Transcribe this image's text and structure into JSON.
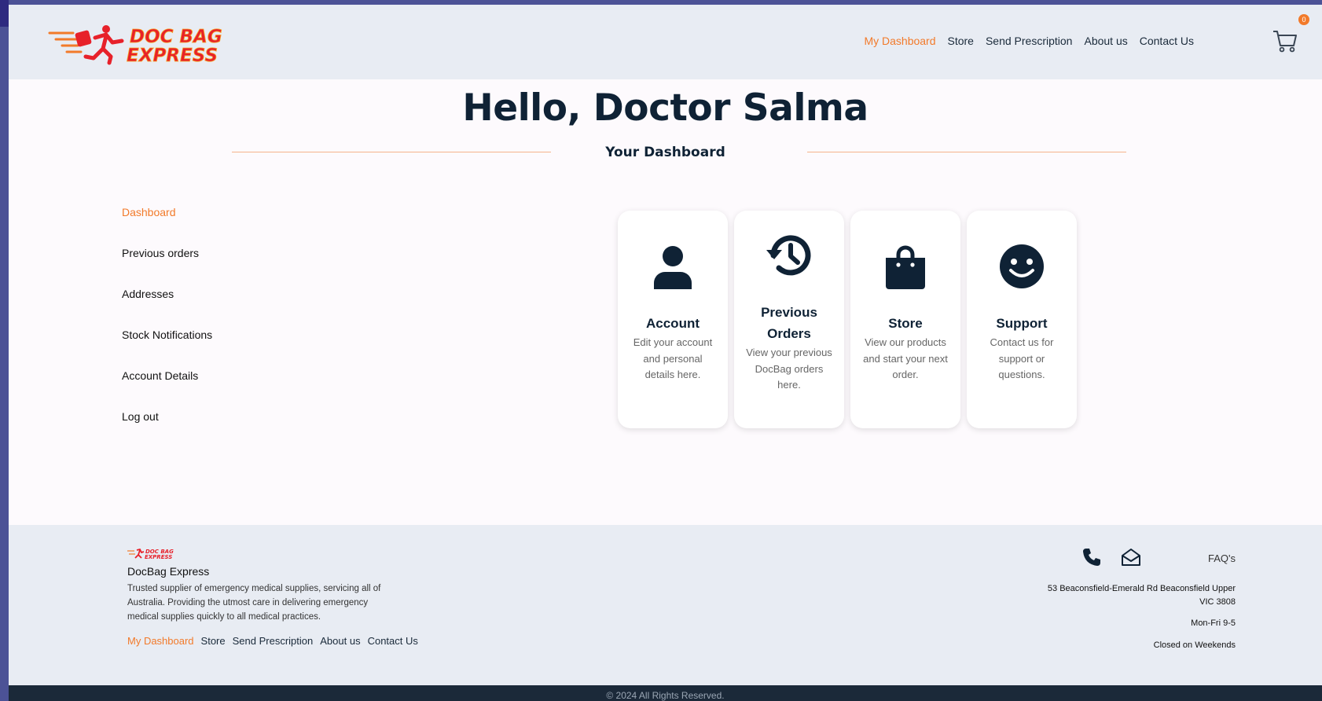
{
  "brand": {
    "logo_text_top": "DOC BAG",
    "logo_text_bottom": "EXPRESS",
    "accent_color": "#f27a2a",
    "dark_color": "#0f2235"
  },
  "nav": {
    "items": [
      "My Dashboard",
      "Store",
      "Send Prescription",
      "About us",
      "Contact Us"
    ],
    "active": "My Dashboard"
  },
  "cart": {
    "count": "0",
    "icon": "cart-icon"
  },
  "greeting": "Hello, Doctor Salma",
  "dashboard_title": "Your Dashboard",
  "sidebar": {
    "items": [
      "Dashboard",
      "Previous orders",
      "Addresses",
      "Stock Notifications",
      "Account Details",
      "Log out"
    ],
    "active": "Dashboard"
  },
  "cards": [
    {
      "icon": "user-icon",
      "title": "Account",
      "desc": "Edit your account and personal details here."
    },
    {
      "icon": "history-icon",
      "title": "Previous Orders",
      "desc": "View your previous DocBag orders here."
    },
    {
      "icon": "shopping-bag-icon",
      "title": "Store",
      "desc": "View our products and start your next order."
    },
    {
      "icon": "smiley-icon",
      "title": "Support",
      "desc": "Contact us for support or questions."
    }
  ],
  "footer": {
    "company": "DocBag Express",
    "description": "Trusted supplier of emergency medical supplies, servicing all of Australia. Providing the utmost care in delivering emergency medical supplies quickly to all medical practices.",
    "nav": [
      "My Dashboard",
      "Store",
      "Send Prescription",
      "About us",
      "Contact Us"
    ],
    "faq": "FAQ's",
    "address_line1": "53 Beaconsfield-Emerald Rd Beaconsfield Upper",
    "address_line2": "VIC 3808",
    "hours": "Mon-Fri 9-5",
    "closed": "Closed on Weekends",
    "copyright": "© 2024 All Rights Reserved."
  }
}
